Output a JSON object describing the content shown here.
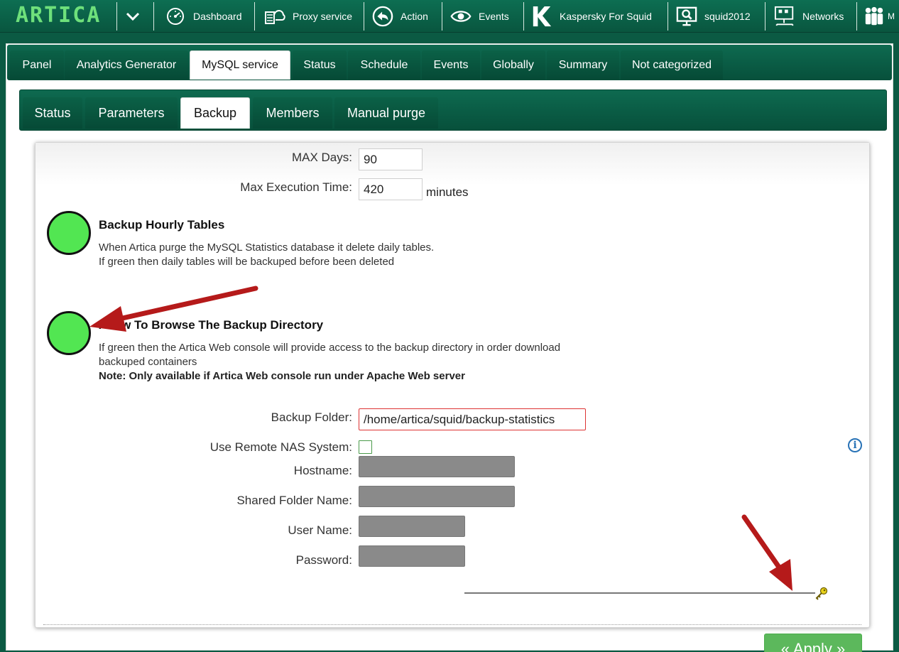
{
  "app": {
    "logo": "ARTICA"
  },
  "topnav": {
    "items": [
      {
        "label": "Dashboard",
        "icon": "speedometer-icon"
      },
      {
        "label": "Proxy service",
        "icon": "proxy-server-icon"
      },
      {
        "label": "Action",
        "icon": "back-arrow-icon"
      },
      {
        "label": "Events",
        "icon": "eye-icon"
      },
      {
        "label": "Kaspersky For Squid",
        "icon": "kaspersky-logo-icon"
      },
      {
        "label": "squid2012",
        "icon": "monitor-search-icon"
      },
      {
        "label": "Networks",
        "icon": "network-icon"
      }
    ],
    "overflow_label": "M"
  },
  "main_tabs": [
    {
      "label": "Panel"
    },
    {
      "label": "Analytics Generator"
    },
    {
      "label": "MySQL service",
      "active": true
    },
    {
      "label": "Status"
    },
    {
      "label": "Schedule"
    },
    {
      "label": "Events"
    },
    {
      "label": "Globally"
    },
    {
      "label": "Summary"
    },
    {
      "label": "Not categorized"
    }
  ],
  "sub_tabs": [
    {
      "label": "Status"
    },
    {
      "label": "Parameters"
    },
    {
      "label": "Backup",
      "active": true
    },
    {
      "label": "Members"
    },
    {
      "label": "Manual purge"
    }
  ],
  "form": {
    "max_days": {
      "label": "MAX Days:",
      "value": "90"
    },
    "max_exec": {
      "label": "Max Execution Time:",
      "value": "420",
      "unit": "minutes"
    },
    "hourly": {
      "title": "Backup Hourly Tables",
      "line1": "When Artica purge the MySQL Statistics database it delete daily tables.",
      "line2": "If green then daily tables will be backuped before been deleted",
      "status_color": "#52e652"
    },
    "browse": {
      "title": "Allow To Browse The Backup Directory",
      "line1": "If green then the Artica Web console will provide access to the backup directory in order download",
      "line2": "backuped containers",
      "note": "Note: Only available if Artica Web console run under Apache Web server",
      "status_color": "#52e652"
    },
    "backup_folder": {
      "label": "Backup Folder:",
      "value": "/home/artica/squid/backup-statistics"
    },
    "remote_nas": {
      "label": "Use Remote NAS System:",
      "checked": false
    },
    "hostname": {
      "label": "Hostname:"
    },
    "shared_folder": {
      "label": "Shared Folder Name:"
    },
    "user_name": {
      "label": "User Name:"
    },
    "password": {
      "label": "Password:"
    },
    "apply_label": "« Apply »"
  },
  "colors": {
    "accent_green": "#0b5a43",
    "button_green": "#5cb85c",
    "annotation_red": "#b51a1a"
  }
}
